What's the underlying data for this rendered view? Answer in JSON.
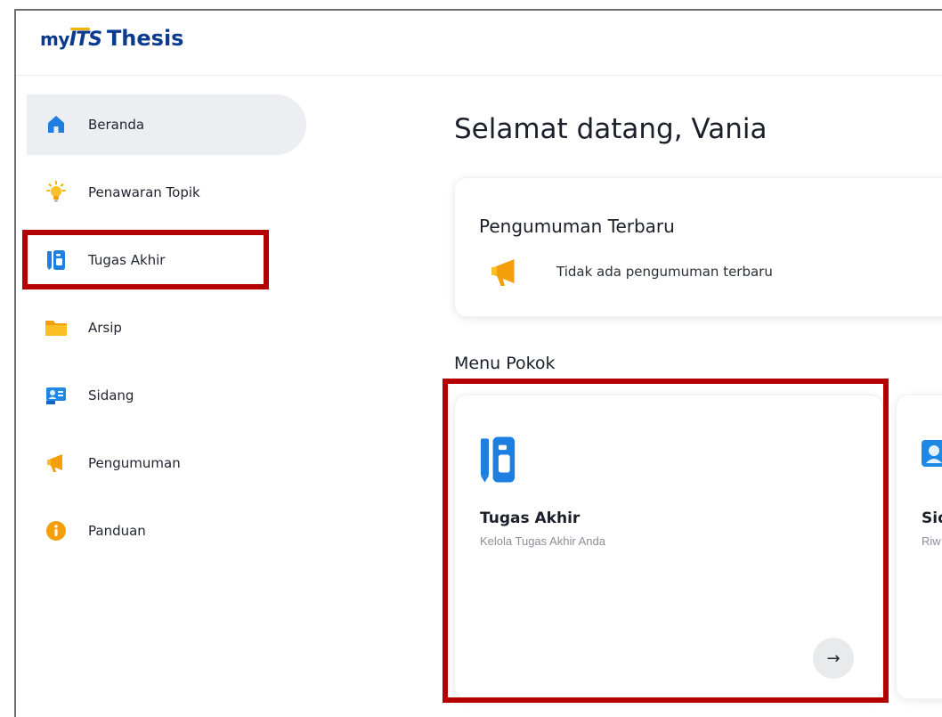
{
  "app": {
    "logo_my": "my",
    "logo_its": "ITS",
    "logo_thesis": "Thesis"
  },
  "sidebar": {
    "items": [
      {
        "label": "Beranda",
        "icon": "home-icon",
        "active": true
      },
      {
        "label": "Penawaran Topik",
        "icon": "lightbulb-icon",
        "active": false
      },
      {
        "label": "Tugas Akhir",
        "icon": "notebook-icon",
        "active": false
      },
      {
        "label": "Arsip",
        "icon": "folder-icon",
        "active": false
      },
      {
        "label": "Sidang",
        "icon": "id-card-icon",
        "active": false
      },
      {
        "label": "Pengumuman",
        "icon": "megaphone-icon",
        "active": false
      },
      {
        "label": "Panduan",
        "icon": "info-icon",
        "active": false
      }
    ]
  },
  "main": {
    "welcome": "Selamat datang, Vania",
    "announcement": {
      "title": "Pengumuman Terbaru",
      "empty_text": "Tidak ada pengumuman terbaru",
      "icon": "megaphone-icon"
    },
    "menu_heading": "Menu Pokok",
    "menu_cards": [
      {
        "title": "Tugas Akhir",
        "desc": "Kelola Tugas Akhir Anda",
        "icon": "notebook-icon",
        "arrow": "→"
      },
      {
        "title": "Sid",
        "desc": "Riw",
        "icon": "id-card-icon"
      }
    ]
  },
  "colors": {
    "brand": "#0b3a8f",
    "highlight": "#b30000",
    "active_bg": "#eceef1",
    "icon_blue": "#1e88e5",
    "icon_orange": "#f59e0b"
  }
}
